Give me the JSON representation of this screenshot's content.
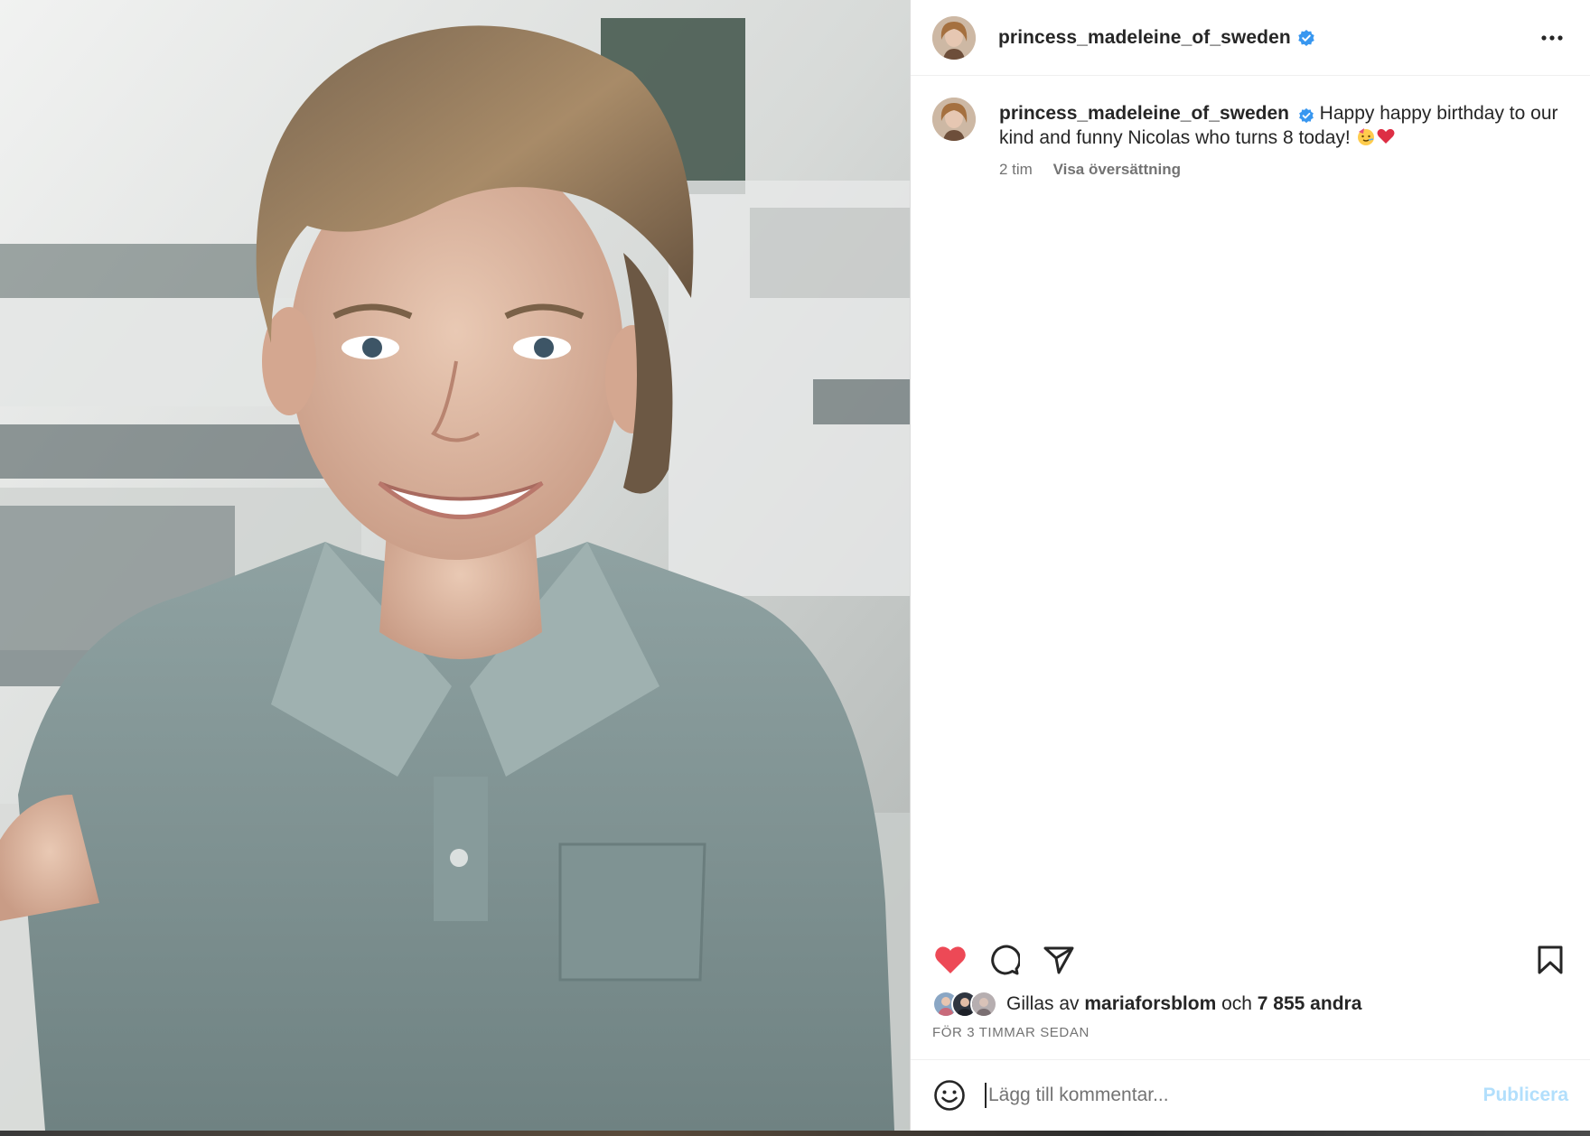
{
  "post": {
    "author": "princess_madeleine_of_sweden",
    "verified": true,
    "photo_description_icon": "post-photo"
  },
  "header": {
    "username": "princess_madeleine_of_sweden",
    "more_icon": "more-horizontal-icon"
  },
  "caption": {
    "username": "princess_madeleine_of_sweden",
    "text": "Happy happy birthday to our kind and funny Nicolas who turns 8 today!",
    "emojis": [
      "partying-face-emoji",
      "red-heart-emoji"
    ],
    "age": "2 tim",
    "translate_label": "Visa översättning"
  },
  "actions": {
    "like_icon": "heart-filled-icon",
    "comment_icon": "comment-icon",
    "share_icon": "share-icon",
    "save_icon": "bookmark-icon",
    "liked": true,
    "like_color": "#ed4956"
  },
  "likes": {
    "prefix": "Gillas av",
    "first_liker": "mariaforsblom",
    "conjunction": "och",
    "others": "7 855 andra"
  },
  "timestamp": "FÖR 3 TIMMAR SEDAN",
  "comment_box": {
    "emoji_icon": "smiley-icon",
    "placeholder": "Lägg till kommentar...",
    "publish_label": "Publicera",
    "publish_color": "#b2dffc"
  },
  "colors": {
    "text_primary": "#262626",
    "text_secondary": "#737373",
    "verified_blue": "#3897f0",
    "border": "#dbdbdb"
  }
}
